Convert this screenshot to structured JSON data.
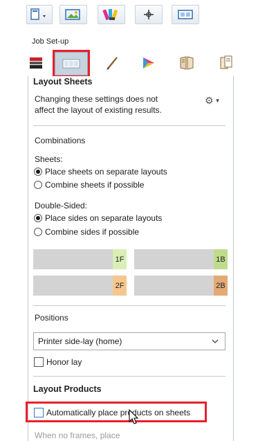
{
  "toolbar": {
    "buttons": [
      {
        "icon": "document-dropdown-icon"
      },
      {
        "icon": "image-tools-icon"
      },
      {
        "icon": "color-swatches-icon"
      },
      {
        "icon": "crosshair-icon"
      },
      {
        "icon": "layout-view-icon"
      }
    ]
  },
  "section_label": "Job Set-up",
  "tabs": [
    {
      "icon": "sheet-stack-icon",
      "selected": false
    },
    {
      "icon": "layout-sheets-icon",
      "selected": true
    },
    {
      "icon": "pen-icon",
      "selected": false
    },
    {
      "icon": "color-triangle-icon",
      "selected": false
    },
    {
      "icon": "book-icon",
      "selected": false
    },
    {
      "icon": "pages-icon",
      "selected": false
    }
  ],
  "layout_sheets": {
    "title": "Layout Sheets",
    "note_line1": "Changing these settings does not",
    "note_line2": "affect the layout of existing results.",
    "combinations_label": "Combinations",
    "sheets_label": "Sheets:",
    "sheets_options": [
      {
        "label": "Place sheets on separate layouts",
        "checked": true
      },
      {
        "label": "Combine sheets if possible",
        "checked": false
      }
    ],
    "double_sided_label": "Double-Sided:",
    "double_sided_options": [
      {
        "label": "Place sides on separate layouts",
        "checked": true
      },
      {
        "label": "Combine sides if possible",
        "checked": false
      }
    ],
    "sheet_previews": [
      {
        "label": "1F",
        "color": "#d9efb5"
      },
      {
        "label": "1B",
        "color": "#bfdc8d"
      },
      {
        "label": "2F",
        "color": "#f5c78e"
      },
      {
        "label": "2B",
        "color": "#e3aa74"
      }
    ],
    "positions_label": "Positions",
    "positions_value": "Printer side-lay (home)",
    "honor_lay_label": "Honor lay",
    "honor_lay_checked": false
  },
  "layout_products": {
    "title": "Layout Products",
    "auto_place_label": "Automatically place products on sheets",
    "auto_place_checked": false,
    "when_no_frames": "When no frames, place"
  },
  "colors": {
    "highlight": "#e8202a"
  }
}
